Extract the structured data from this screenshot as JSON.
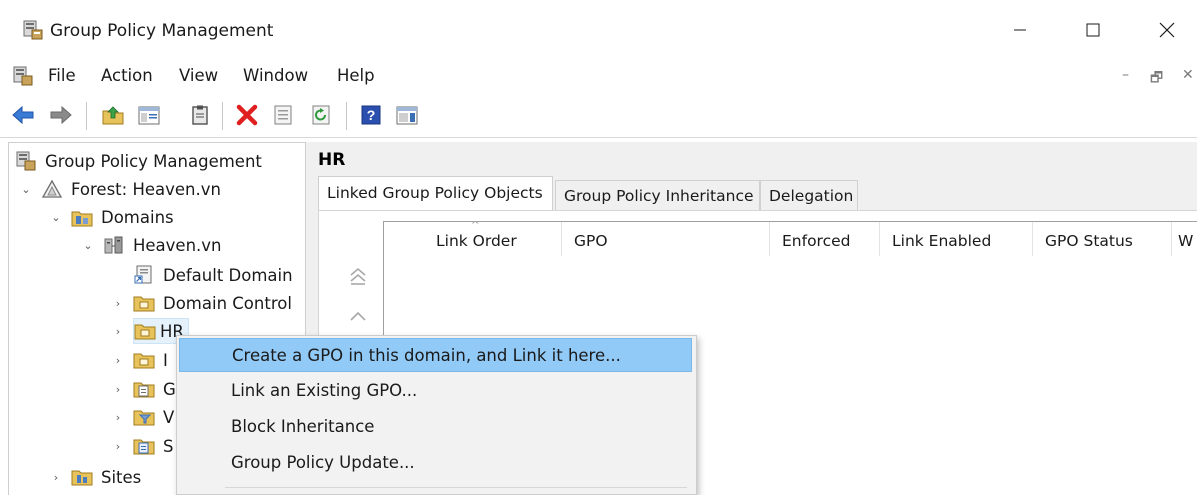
{
  "window": {
    "title": "Group Policy Management",
    "icons": {
      "app": "gpm-console-icon",
      "minimize": "minimize-icon",
      "maximize": "maximize-icon",
      "close": "close-icon"
    }
  },
  "menubar": {
    "items": [
      "File",
      "Action",
      "View",
      "Window",
      "Help"
    ],
    "mdi_controls": {
      "minimize": "–",
      "restore": "🗗",
      "close": "✕"
    }
  },
  "toolbar": {
    "buttons": [
      "back-arrow-icon",
      "forward-arrow-icon",
      "up-folder-icon",
      "show-hide-tree-icon",
      "clipboard-icon",
      "delete-icon",
      "properties-icon",
      "refresh-icon",
      "help-icon",
      "action-pane-icon"
    ]
  },
  "tree": {
    "items": [
      {
        "label": "Group Policy Management",
        "icon": "gpm-console-icon",
        "expander": ""
      },
      {
        "label": "Forest: Heaven.vn",
        "icon": "forest-icon",
        "expander": "⌄"
      },
      {
        "label": "Domains",
        "icon": "domains-folder-icon",
        "expander": "⌄"
      },
      {
        "label": "Heaven.vn",
        "icon": "domain-icon",
        "expander": "⌄"
      },
      {
        "label": "Default Domain",
        "icon": "gpo-link-icon",
        "expander": ""
      },
      {
        "label": "Domain Control",
        "icon": "ou-folder-icon",
        "expander": "›"
      },
      {
        "label": "HR",
        "icon": "ou-folder-icon",
        "expander": "›"
      },
      {
        "label": "I",
        "icon": "ou-folder-icon",
        "expander": "›"
      },
      {
        "label": "G",
        "icon": "gpo-objects-icon",
        "expander": "›"
      },
      {
        "label": "V",
        "icon": "wmi-filters-icon",
        "expander": "›"
      },
      {
        "label": "S",
        "icon": "starter-gpo-icon",
        "expander": "›"
      },
      {
        "label": "Sites",
        "icon": "sites-folder-icon",
        "expander": "›"
      }
    ]
  },
  "content": {
    "header": "HR",
    "tabs": [
      "Linked Group Policy Objects",
      "Group Policy Inheritance",
      "Delegation"
    ],
    "active_tab": 0,
    "columns": [
      "Link Order",
      "GPO",
      "Enforced",
      "Link Enabled",
      "GPO Status",
      "W"
    ],
    "sort_glyph": "^",
    "move_buttons": [
      "move-top-icon",
      "move-up-icon"
    ]
  },
  "context_menu": {
    "items": [
      "Create a GPO in this domain, and Link it here...",
      "Link an Existing GPO...",
      "Block Inheritance",
      "Group Policy Update..."
    ],
    "highlighted": 0
  },
  "colors": {
    "highlight": "#91c9f7",
    "selection": "#e5f1fb",
    "pane_bg": "#f0f0f0",
    "delete_red": "#e02020",
    "help_blue": "#2b4fae",
    "nav_blue": "#3a7bd5"
  }
}
